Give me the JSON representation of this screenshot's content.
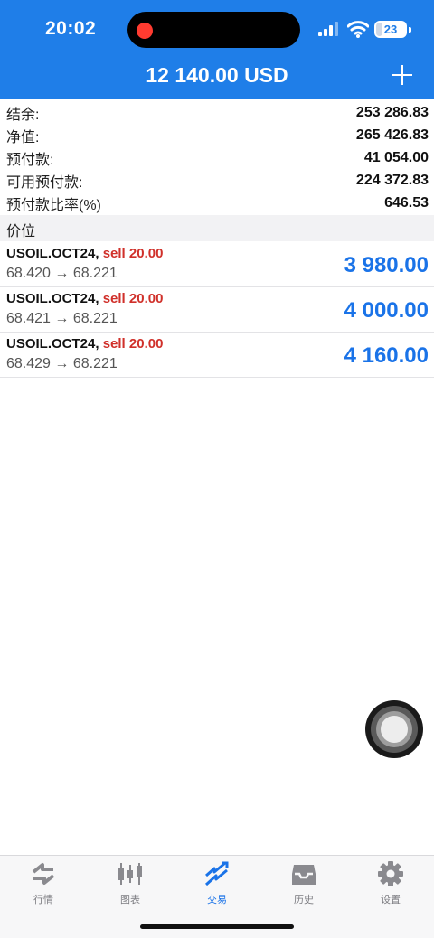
{
  "status_bar": {
    "time": "20:02",
    "battery": "23",
    "battery_level": 0.23
  },
  "header": {
    "title": "12 140.00 USD",
    "add_icon": "plus-icon"
  },
  "summary": [
    {
      "label": "结余:",
      "value": "253 286.83"
    },
    {
      "label": "净值:",
      "value": "265 426.83"
    },
    {
      "label": "预付款:",
      "value": "41 054.00"
    },
    {
      "label": "可用预付款:",
      "value": "224 372.83"
    },
    {
      "label": "预付款比率(%)",
      "value": "646.53"
    }
  ],
  "section_title": "价位",
  "positions": [
    {
      "symbol": "USOIL.OCT24,",
      "side": "sell 20.00",
      "prices": "68.420 → 68.221",
      "profit": "3 980.00"
    },
    {
      "symbol": "USOIL.OCT24,",
      "side": "sell 20.00",
      "prices": "68.421 → 68.221",
      "profit": "4 000.00"
    },
    {
      "symbol": "USOIL.OCT24,",
      "side": "sell 20.00",
      "prices": "68.429 → 68.221",
      "profit": "4 160.00"
    }
  ],
  "tabs": [
    {
      "label": "行情",
      "icon": "quotes-icon"
    },
    {
      "label": "图表",
      "icon": "chart-icon"
    },
    {
      "label": "交易",
      "icon": "trade-icon",
      "active": true
    },
    {
      "label": "历史",
      "icon": "history-icon"
    },
    {
      "label": "设置",
      "icon": "settings-icon"
    }
  ],
  "colors": {
    "accent": "#1f7ee8",
    "profit": "#1a73e8",
    "sell": "#d0302a"
  }
}
